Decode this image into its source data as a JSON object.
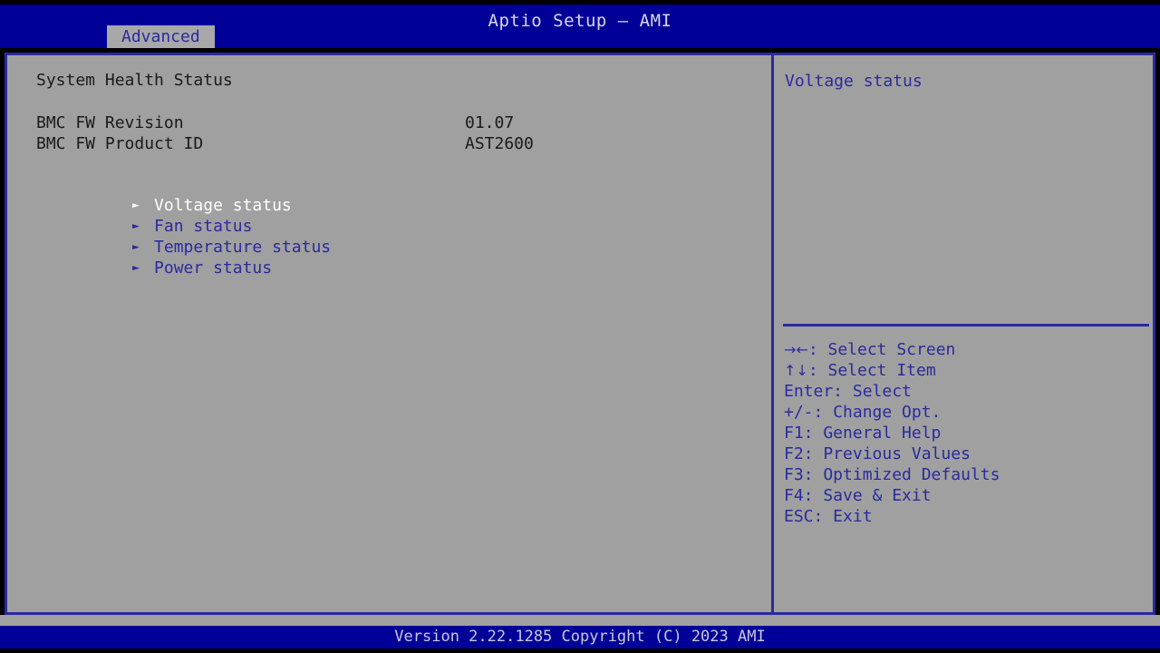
{
  "window": {
    "app_title": "Aptio Setup – AMI"
  },
  "menubar": {
    "tabs": [
      {
        "label": "Advanced",
        "active": true
      }
    ]
  },
  "main": {
    "section_title": "System Health Status",
    "info": [
      {
        "label": "BMC FW Revision",
        "value": "01.07"
      },
      {
        "label": "BMC FW Product ID",
        "value": "AST2600"
      }
    ],
    "menu_items": [
      {
        "label": "Voltage status",
        "arrow": "submenu-arrow",
        "selected": true
      },
      {
        "label": "Fan status",
        "arrow": "submenu-arrow",
        "selected": false
      },
      {
        "label": "Temperature status",
        "arrow": "submenu-arrow",
        "selected": false
      },
      {
        "label": "Power status",
        "arrow": "submenu-arrow",
        "selected": false
      }
    ]
  },
  "help_panel": {
    "description": "Voltage status",
    "keys": [
      {
        "glyph": "→←",
        "text": ": Select Screen"
      },
      {
        "glyph": "↑↓",
        "text": ": Select Item"
      },
      {
        "glyph": "",
        "text": "Enter: Select"
      },
      {
        "glyph": "",
        "text": "+/-: Change Opt."
      },
      {
        "glyph": "",
        "text": "F1: General Help"
      },
      {
        "glyph": "",
        "text": "F2: Previous Values"
      },
      {
        "glyph": "",
        "text": "F3: Optimized Defaults"
      },
      {
        "glyph": "",
        "text": "F4: Save & Exit"
      },
      {
        "glyph": "",
        "text": "ESC: Exit"
      }
    ]
  },
  "footer": {
    "version_text": "Version 2.22.1285 Copyright (C) 2023 AMI"
  },
  "colors": {
    "background_blue": "#000099",
    "panel_gray": "#a0a0a0",
    "border_blue": "#2a2a9e",
    "text_blue": "#2a2a9e",
    "text_dark": "#1a1a1a",
    "text_selected": "#ffffff",
    "title_text": "#d8d8e8"
  }
}
